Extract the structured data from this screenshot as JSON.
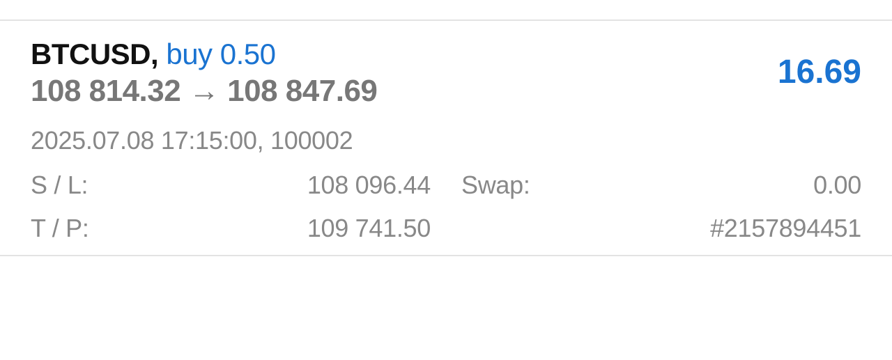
{
  "position": {
    "symbol": "BTCUSD,",
    "trade_type": "buy 0.50",
    "price_line": "108 814.32 → 108 847.69",
    "profit": "16.69",
    "meta": "2025.07.08 17:15:00, 100002",
    "details": {
      "sl_label": "S / L:",
      "sl_value": "108 096.44",
      "swap_label": "Swap:",
      "swap_value": "0.00",
      "tp_label": "T / P:",
      "tp_value": "109 741.50",
      "ticket": "#2157894451"
    }
  },
  "colors": {
    "accent": "#1a73d1",
    "symbol": "#111111",
    "muted": "#888888",
    "price": "#777777",
    "divider": "#e3e3e3"
  }
}
